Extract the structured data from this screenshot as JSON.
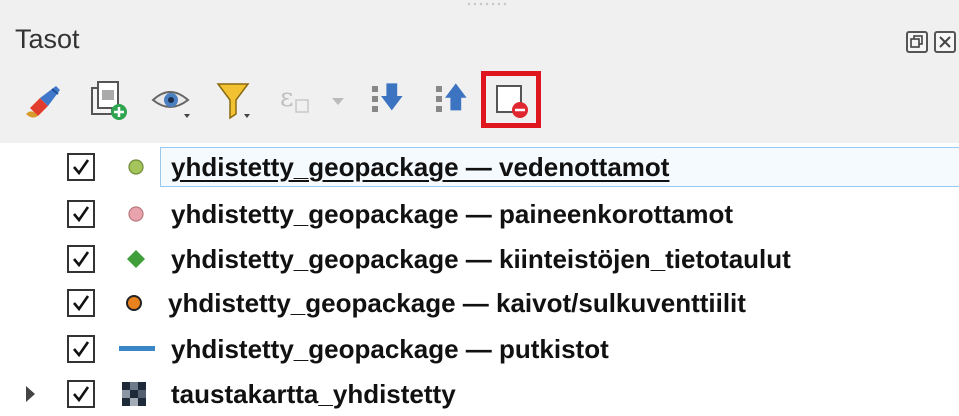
{
  "panel": {
    "title": "Tasot"
  },
  "toolbar": {
    "buttons": [
      {
        "name": "style-manager-button",
        "icon": "paintbrush-icon"
      },
      {
        "name": "add-group-button",
        "icon": "add-group-icon"
      },
      {
        "name": "visibility-button",
        "icon": "eye-icon"
      },
      {
        "name": "filter-button",
        "icon": "filter-icon"
      },
      {
        "name": "expression-filter-button",
        "icon": "expression-icon",
        "disabled": true
      },
      {
        "name": "expand-all-button",
        "icon": "expand-all-icon"
      },
      {
        "name": "collapse-all-button",
        "icon": "collapse-all-icon"
      },
      {
        "name": "remove-layer-button",
        "icon": "remove-layer-icon",
        "highlighted": true
      }
    ]
  },
  "layers": [
    {
      "label": "yhdistetty_geopackage — vedenottamot",
      "checked": true,
      "symbol": "circle",
      "color": "#a5c45b",
      "selected": true
    },
    {
      "label": "yhdistetty_geopackage — paineenkorottamot",
      "checked": true,
      "symbol": "circle",
      "color": "#e9a3ad"
    },
    {
      "label": "yhdistetty_geopackage — kiinteistöjen_tietotaulut",
      "checked": true,
      "symbol": "diamond",
      "color": "#3f9e3a"
    },
    {
      "label": "yhdistetty_geopackage — kaivot/sulkuventtiilit",
      "checked": true,
      "symbol": "circle",
      "color": "#e8821e"
    },
    {
      "label": "yhdistetty_geopackage — putkistot",
      "checked": true,
      "symbol": "line",
      "color": "#3b86c6"
    },
    {
      "label": "taustakartta_yhdistetty",
      "checked": true,
      "symbol": "raster",
      "color": "#1c2a3a",
      "expandable": true
    }
  ],
  "colors": {
    "highlight": "#e0161e",
    "selection_border": "#99c9ef"
  }
}
